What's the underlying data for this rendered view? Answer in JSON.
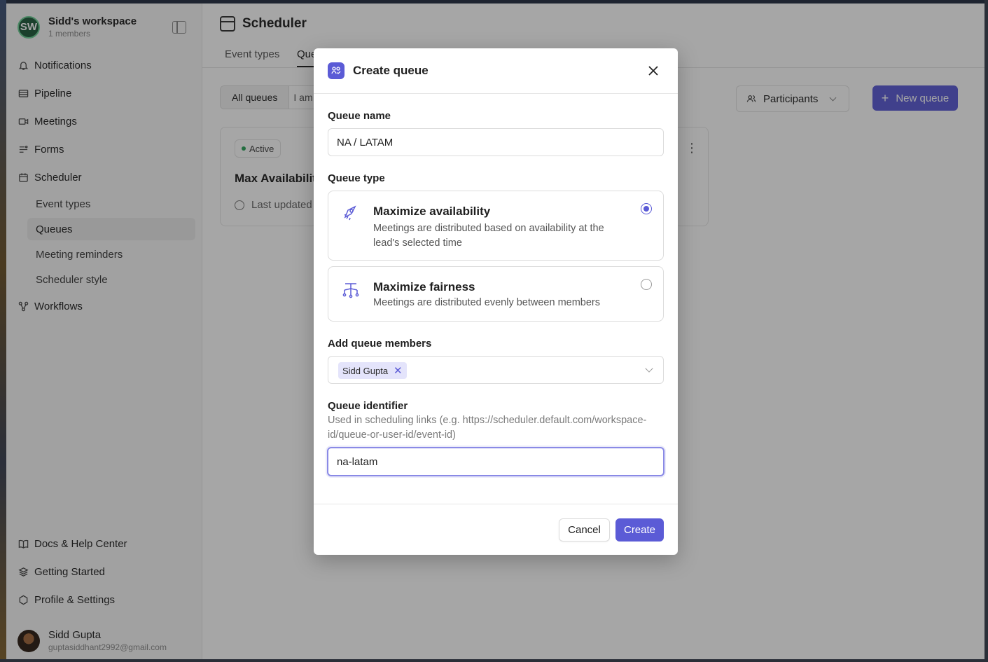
{
  "workspace": {
    "logo_text": "SW",
    "name": "Sidd's workspace",
    "members": "1 members"
  },
  "sidebar": {
    "items": [
      {
        "label": "Notifications",
        "icon": "bell-icon"
      },
      {
        "label": "Pipeline",
        "icon": "pipeline-icon"
      },
      {
        "label": "Meetings",
        "icon": "video-icon"
      },
      {
        "label": "Forms",
        "icon": "forms-icon"
      },
      {
        "label": "Scheduler",
        "icon": "calendar-icon"
      },
      {
        "label": "Workflows",
        "icon": "workflow-icon"
      }
    ],
    "scheduler_sub": [
      "Event types",
      "Queues",
      "Meeting reminders",
      "Scheduler style"
    ],
    "active_sub": "Queues",
    "bottom": [
      {
        "label": "Docs & Help Center",
        "icon": "book-icon"
      },
      {
        "label": "Getting Started",
        "icon": "stack-icon"
      },
      {
        "label": "Profile & Settings",
        "icon": "hexagon-icon"
      }
    ],
    "user": {
      "name": "Sidd Gupta",
      "email": "guptasiddhant2992@gmail.com"
    }
  },
  "main": {
    "title": "Scheduler",
    "tabs": [
      "Event types",
      "Que"
    ],
    "filters": [
      "All queues",
      "I am"
    ],
    "participants_label": "Participants",
    "new_queue_label": "New queue",
    "card": {
      "status": "Active",
      "title": "Max Availability",
      "updated": "Last updated"
    }
  },
  "modal": {
    "title": "Create queue",
    "queue_name_label": "Queue name",
    "queue_name_value": "NA / LATAM",
    "queue_type_label": "Queue type",
    "options": [
      {
        "title": "Maximize availability",
        "desc": "Meetings are distributed based on availability at the lead's selected time",
        "selected": true
      },
      {
        "title": "Maximize fairness",
        "desc": "Meetings are distributed evenly between members",
        "selected": false
      }
    ],
    "members_label": "Add queue members",
    "members": [
      "Sidd Gupta"
    ],
    "identifier_label": "Queue identifier",
    "identifier_hint": "Used in scheduling links (e.g. https://scheduler.default.com/workspace-id/queue-or-user-id/event-id)",
    "identifier_value": "na-latam",
    "cancel_label": "Cancel",
    "create_label": "Create"
  },
  "colors": {
    "accent": "#5b5bd6",
    "active_dot": "#2aa35a"
  }
}
